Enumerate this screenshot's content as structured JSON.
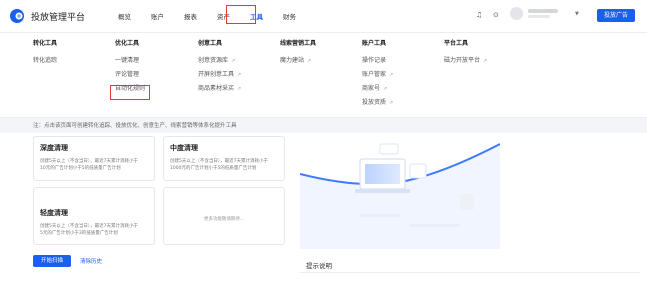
{
  "app": {
    "title": "投放管理平台"
  },
  "nav": {
    "items": [
      "概览",
      "账户",
      "报表",
      "资产",
      "工具",
      "财务"
    ],
    "active_index": 4
  },
  "toolbar": {
    "cta_label": "投放广告"
  },
  "menu": {
    "columns": [
      {
        "head": "转化工具",
        "items": [
          {
            "label": "转化追踪",
            "ext": false
          }
        ]
      },
      {
        "head": "优化工具",
        "items": [
          {
            "label": "一键清理",
            "ext": false
          },
          {
            "label": "评论管理",
            "ext": false
          },
          {
            "label": "自动化规则",
            "ext": false
          }
        ]
      },
      {
        "head": "创意工具",
        "items": [
          {
            "label": "创意资源库",
            "ext": true
          },
          {
            "label": "开屏创意工具",
            "ext": true
          },
          {
            "label": "商品素材采买",
            "ext": true
          }
        ]
      },
      {
        "head": "线索营销工具",
        "items": [
          {
            "label": "魔力建站",
            "ext": true
          }
        ]
      },
      {
        "head": "账户工具",
        "items": [
          {
            "label": "操作记录",
            "ext": false
          },
          {
            "label": "账户管家",
            "ext": true
          },
          {
            "label": "商家号",
            "ext": true
          },
          {
            "label": "投放资质",
            "ext": true
          }
        ]
      },
      {
        "head": "平台工具",
        "items": [
          {
            "label": "磁力开放平台",
            "ext": true
          }
        ]
      }
    ]
  },
  "note": {
    "text": "注：点击该页面可创建转化追踪、投放优化、创意生产、线索营销等体系化提升工具"
  },
  "cards": [
    {
      "title": "深度清理",
      "desc": "创建5天以上（不含当日），最近7天累计消耗小于10元的广告计划小于5的低质量广告计划"
    },
    {
      "title": "中度清理",
      "desc": "创建5天以上（不含当日），最近7天累计消耗小于1000元的广告计划小于5的低质量广告计划"
    },
    {
      "title": "轻度清理",
      "desc": "创建5天以上（不含当日），最近7天累计消耗小于5元的广告计划小于3的低质量广告计划"
    },
    {
      "title": "",
      "desc": "更多功能敬请期待..."
    }
  ],
  "actions": {
    "start_label": "开始扫描",
    "clear_label": "清除历史"
  },
  "tips": {
    "title": "提示说明"
  },
  "colors": {
    "accent": "#1a5ff0",
    "highlight": "#e53935"
  }
}
